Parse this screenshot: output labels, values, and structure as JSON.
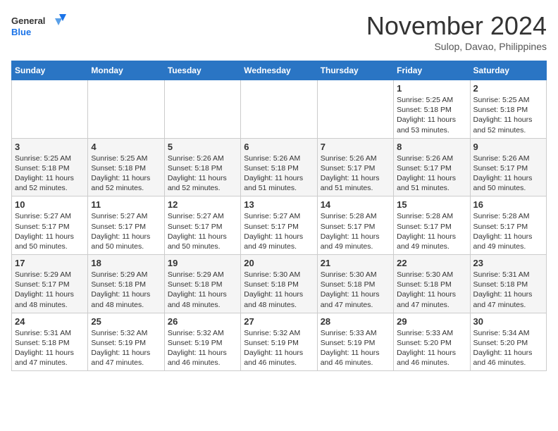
{
  "header": {
    "logo_line1": "General",
    "logo_line2": "Blue",
    "month": "November 2024",
    "location": "Sulop, Davao, Philippines"
  },
  "weekdays": [
    "Sunday",
    "Monday",
    "Tuesday",
    "Wednesday",
    "Thursday",
    "Friday",
    "Saturday"
  ],
  "weeks": [
    [
      {
        "day": "",
        "info": ""
      },
      {
        "day": "",
        "info": ""
      },
      {
        "day": "",
        "info": ""
      },
      {
        "day": "",
        "info": ""
      },
      {
        "day": "",
        "info": ""
      },
      {
        "day": "1",
        "info": "Sunrise: 5:25 AM\nSunset: 5:18 PM\nDaylight: 11 hours\nand 53 minutes."
      },
      {
        "day": "2",
        "info": "Sunrise: 5:25 AM\nSunset: 5:18 PM\nDaylight: 11 hours\nand 52 minutes."
      }
    ],
    [
      {
        "day": "3",
        "info": "Sunrise: 5:25 AM\nSunset: 5:18 PM\nDaylight: 11 hours\nand 52 minutes."
      },
      {
        "day": "4",
        "info": "Sunrise: 5:25 AM\nSunset: 5:18 PM\nDaylight: 11 hours\nand 52 minutes."
      },
      {
        "day": "5",
        "info": "Sunrise: 5:26 AM\nSunset: 5:18 PM\nDaylight: 11 hours\nand 52 minutes."
      },
      {
        "day": "6",
        "info": "Sunrise: 5:26 AM\nSunset: 5:18 PM\nDaylight: 11 hours\nand 51 minutes."
      },
      {
        "day": "7",
        "info": "Sunrise: 5:26 AM\nSunset: 5:17 PM\nDaylight: 11 hours\nand 51 minutes."
      },
      {
        "day": "8",
        "info": "Sunrise: 5:26 AM\nSunset: 5:17 PM\nDaylight: 11 hours\nand 51 minutes."
      },
      {
        "day": "9",
        "info": "Sunrise: 5:26 AM\nSunset: 5:17 PM\nDaylight: 11 hours\nand 50 minutes."
      }
    ],
    [
      {
        "day": "10",
        "info": "Sunrise: 5:27 AM\nSunset: 5:17 PM\nDaylight: 11 hours\nand 50 minutes."
      },
      {
        "day": "11",
        "info": "Sunrise: 5:27 AM\nSunset: 5:17 PM\nDaylight: 11 hours\nand 50 minutes."
      },
      {
        "day": "12",
        "info": "Sunrise: 5:27 AM\nSunset: 5:17 PM\nDaylight: 11 hours\nand 50 minutes."
      },
      {
        "day": "13",
        "info": "Sunrise: 5:27 AM\nSunset: 5:17 PM\nDaylight: 11 hours\nand 49 minutes."
      },
      {
        "day": "14",
        "info": "Sunrise: 5:28 AM\nSunset: 5:17 PM\nDaylight: 11 hours\nand 49 minutes."
      },
      {
        "day": "15",
        "info": "Sunrise: 5:28 AM\nSunset: 5:17 PM\nDaylight: 11 hours\nand 49 minutes."
      },
      {
        "day": "16",
        "info": "Sunrise: 5:28 AM\nSunset: 5:17 PM\nDaylight: 11 hours\nand 49 minutes."
      }
    ],
    [
      {
        "day": "17",
        "info": "Sunrise: 5:29 AM\nSunset: 5:17 PM\nDaylight: 11 hours\nand 48 minutes."
      },
      {
        "day": "18",
        "info": "Sunrise: 5:29 AM\nSunset: 5:18 PM\nDaylight: 11 hours\nand 48 minutes."
      },
      {
        "day": "19",
        "info": "Sunrise: 5:29 AM\nSunset: 5:18 PM\nDaylight: 11 hours\nand 48 minutes."
      },
      {
        "day": "20",
        "info": "Sunrise: 5:30 AM\nSunset: 5:18 PM\nDaylight: 11 hours\nand 48 minutes."
      },
      {
        "day": "21",
        "info": "Sunrise: 5:30 AM\nSunset: 5:18 PM\nDaylight: 11 hours\nand 47 minutes."
      },
      {
        "day": "22",
        "info": "Sunrise: 5:30 AM\nSunset: 5:18 PM\nDaylight: 11 hours\nand 47 minutes."
      },
      {
        "day": "23",
        "info": "Sunrise: 5:31 AM\nSunset: 5:18 PM\nDaylight: 11 hours\nand 47 minutes."
      }
    ],
    [
      {
        "day": "24",
        "info": "Sunrise: 5:31 AM\nSunset: 5:18 PM\nDaylight: 11 hours\nand 47 minutes."
      },
      {
        "day": "25",
        "info": "Sunrise: 5:32 AM\nSunset: 5:19 PM\nDaylight: 11 hours\nand 47 minutes."
      },
      {
        "day": "26",
        "info": "Sunrise: 5:32 AM\nSunset: 5:19 PM\nDaylight: 11 hours\nand 46 minutes."
      },
      {
        "day": "27",
        "info": "Sunrise: 5:32 AM\nSunset: 5:19 PM\nDaylight: 11 hours\nand 46 minutes."
      },
      {
        "day": "28",
        "info": "Sunrise: 5:33 AM\nSunset: 5:19 PM\nDaylight: 11 hours\nand 46 minutes."
      },
      {
        "day": "29",
        "info": "Sunrise: 5:33 AM\nSunset: 5:20 PM\nDaylight: 11 hours\nand 46 minutes."
      },
      {
        "day": "30",
        "info": "Sunrise: 5:34 AM\nSunset: 5:20 PM\nDaylight: 11 hours\nand 46 minutes."
      }
    ]
  ]
}
